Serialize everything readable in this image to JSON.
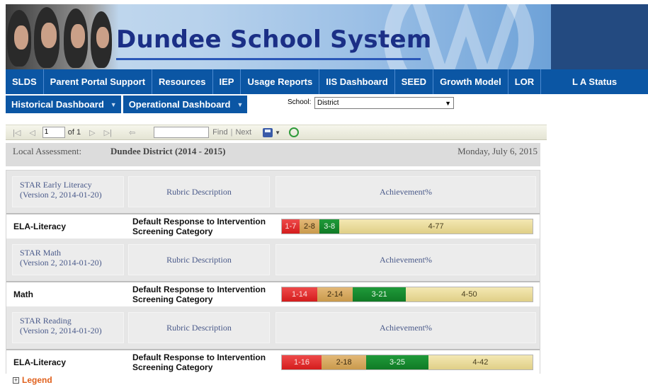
{
  "banner": {
    "title": "Dundee School System"
  },
  "nav": {
    "items": [
      "SLDS",
      "Parent Portal Support",
      "Resources",
      "IEP",
      "Usage Reports",
      "IIS Dashboard",
      "SEED",
      "Growth Model",
      "LOR",
      "L A Status"
    ]
  },
  "subnav": {
    "historical": "Historical Dashboard",
    "operational": "Operational Dashboard",
    "school_label": "School:",
    "school_value": "District"
  },
  "toolbar": {
    "page_value": "1",
    "of_label": "of 1",
    "find_label": "Find",
    "separator": "|",
    "next_label": "Next"
  },
  "report_header": {
    "label": "Local Assessment:",
    "district": "Dundee District",
    "year": "(2014 - 2015)",
    "date": "Monday, July 6, 2015"
  },
  "rubric_header": "Rubric Description",
  "achievement_header": "Achievement%",
  "assessments": [
    {
      "name": "STAR Early Literacy",
      "version": "(Version 2, 2014-01-20)",
      "subject": "ELA-Literacy",
      "rubric_line1": "Default Response to Intervention",
      "rubric_line2": "Screening Category",
      "segments": [
        {
          "label": "1-7",
          "percent": 7
        },
        {
          "label": "2-8",
          "percent": 8
        },
        {
          "label": "3-8",
          "percent": 8
        },
        {
          "label": "4-77",
          "percent": 77
        }
      ]
    },
    {
      "name": "STAR Math",
      "version": "(Version 2, 2014-01-20)",
      "subject": "Math",
      "rubric_line1": "Default Response to Intervention",
      "rubric_line2": "Screening Category",
      "segments": [
        {
          "label": "1-14",
          "percent": 14
        },
        {
          "label": "2-14",
          "percent": 14
        },
        {
          "label": "3-21",
          "percent": 21
        },
        {
          "label": "4-50",
          "percent": 50
        }
      ]
    },
    {
      "name": "STAR Reading",
      "version": "(Version 2, 2014-01-20)",
      "subject": "ELA-Literacy",
      "rubric_line1": "Default Response to Intervention",
      "rubric_line2": "Screening Category",
      "segments": [
        {
          "label": "1-16",
          "percent": 16
        },
        {
          "label": "2-18",
          "percent": 18
        },
        {
          "label": "3-25",
          "percent": 25
        },
        {
          "label": "4-42",
          "percent": 42
        }
      ]
    }
  ],
  "legend": {
    "toggle": "+",
    "label": "Legend"
  }
}
